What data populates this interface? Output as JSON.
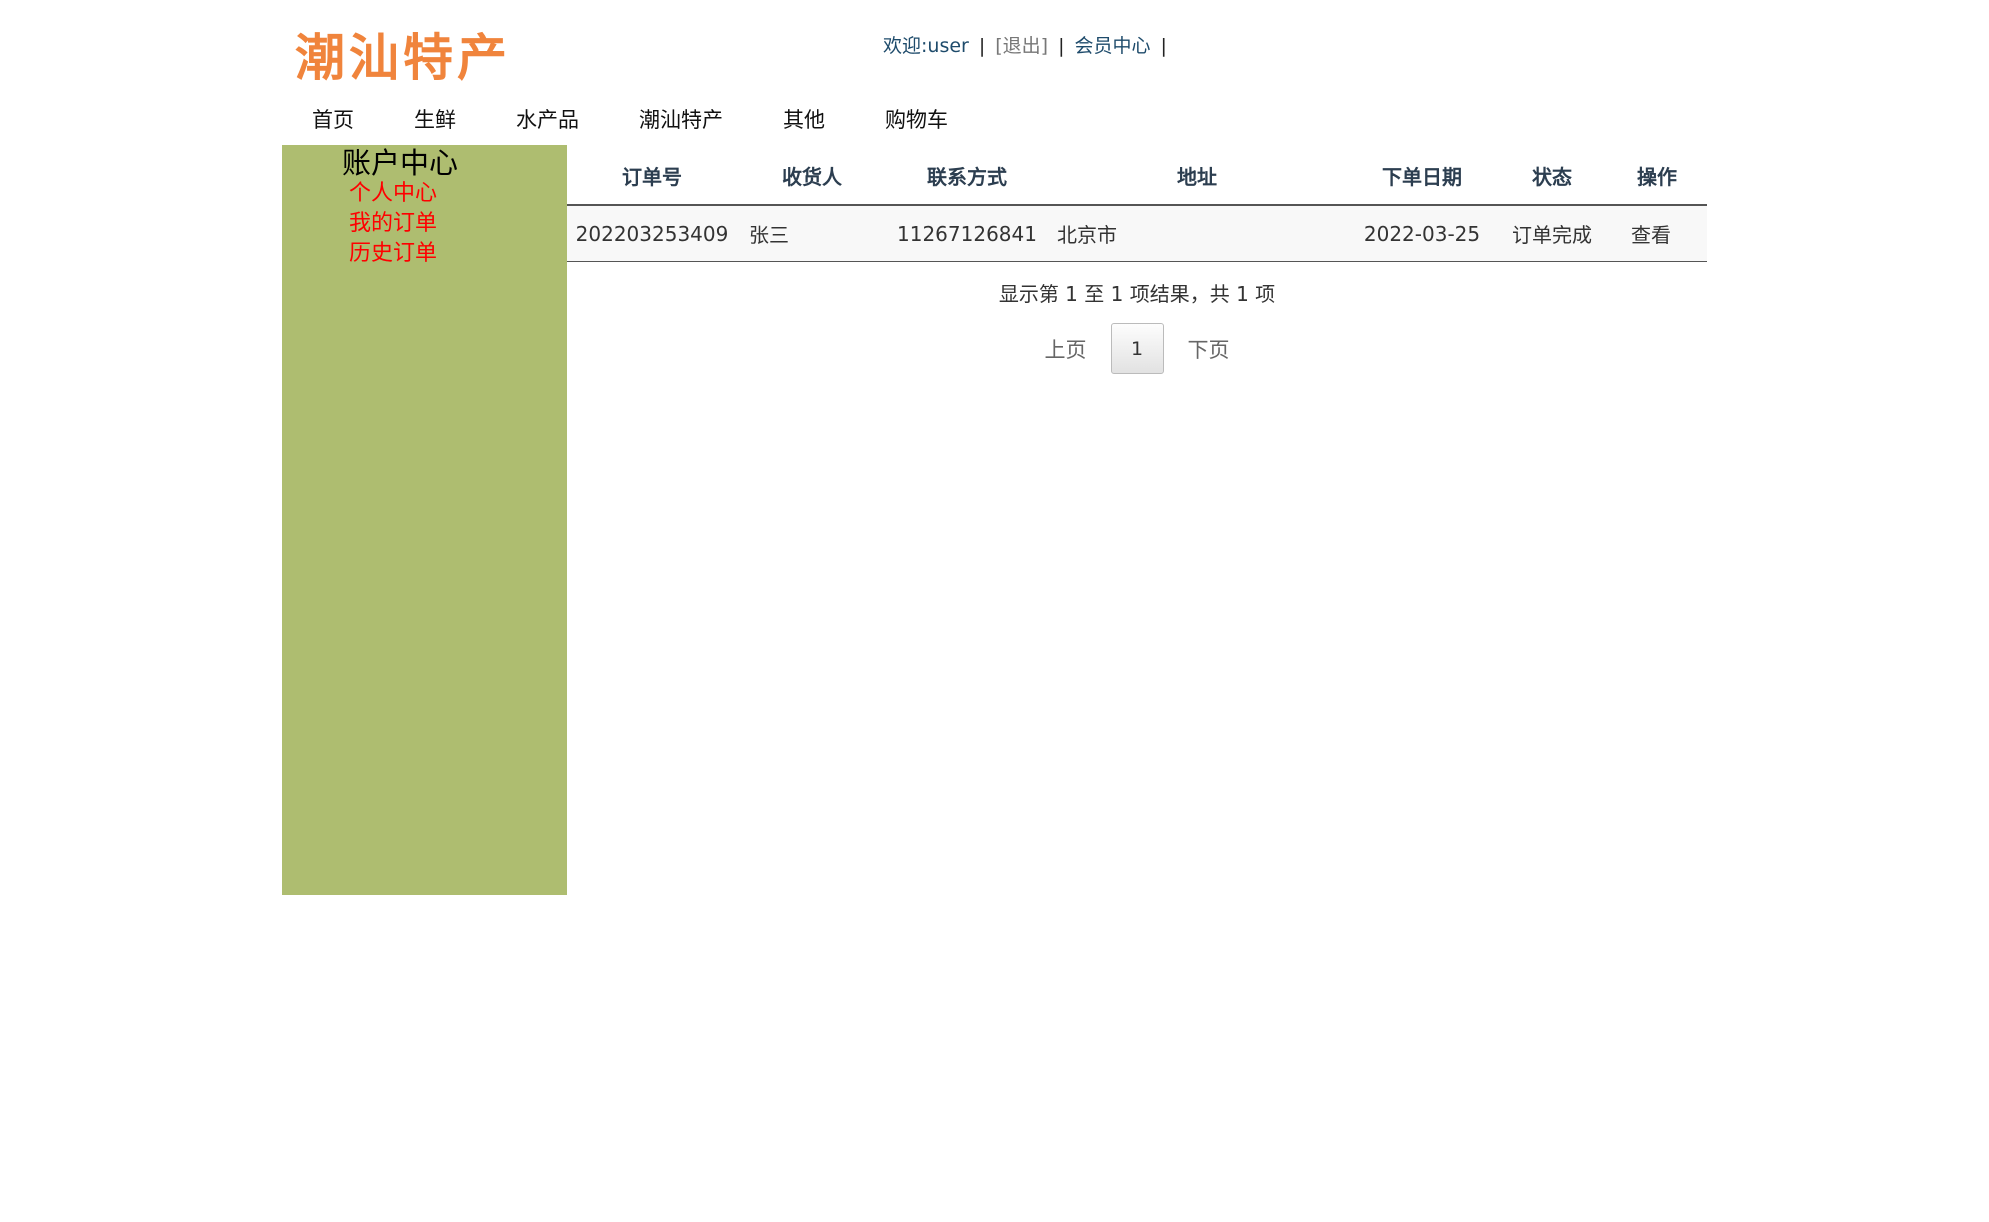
{
  "header": {
    "logo_text": "潮汕特产",
    "welcome_text": "欢迎:user",
    "logout_text": "[退出]",
    "member_center_text": "会员中心",
    "separator": "|"
  },
  "nav": {
    "items": [
      {
        "label": "首页"
      },
      {
        "label": "生鲜"
      },
      {
        "label": "水产品"
      },
      {
        "label": "潮汕特产"
      },
      {
        "label": "其他"
      },
      {
        "label": "购物车"
      }
    ]
  },
  "sidebar": {
    "title": "账户中心",
    "items": [
      {
        "label": "个人中心"
      },
      {
        "label": "我的订单"
      },
      {
        "label": "历史订单"
      }
    ]
  },
  "orders_table": {
    "headers": [
      "订单号",
      "收货人",
      "联系方式",
      "地址",
      "下单日期",
      "状态",
      "操作"
    ],
    "rows": [
      {
        "order_no": "202203253409",
        "recipient": "张三",
        "contact": "11267126841",
        "address": "北京市",
        "date": "2022-03-25",
        "status": "订单完成",
        "action": "查看"
      }
    ]
  },
  "pagination": {
    "summary": "显示第 1 至 1 项结果，共 1 项",
    "prev_label": "上页",
    "current_page": "1",
    "next_label": "下页"
  },
  "colors": {
    "logo": "#f0843c",
    "sidebar_bg": "#aebd70",
    "sidebar_link": "#ff0000",
    "header_link": "#1e4b6b"
  }
}
